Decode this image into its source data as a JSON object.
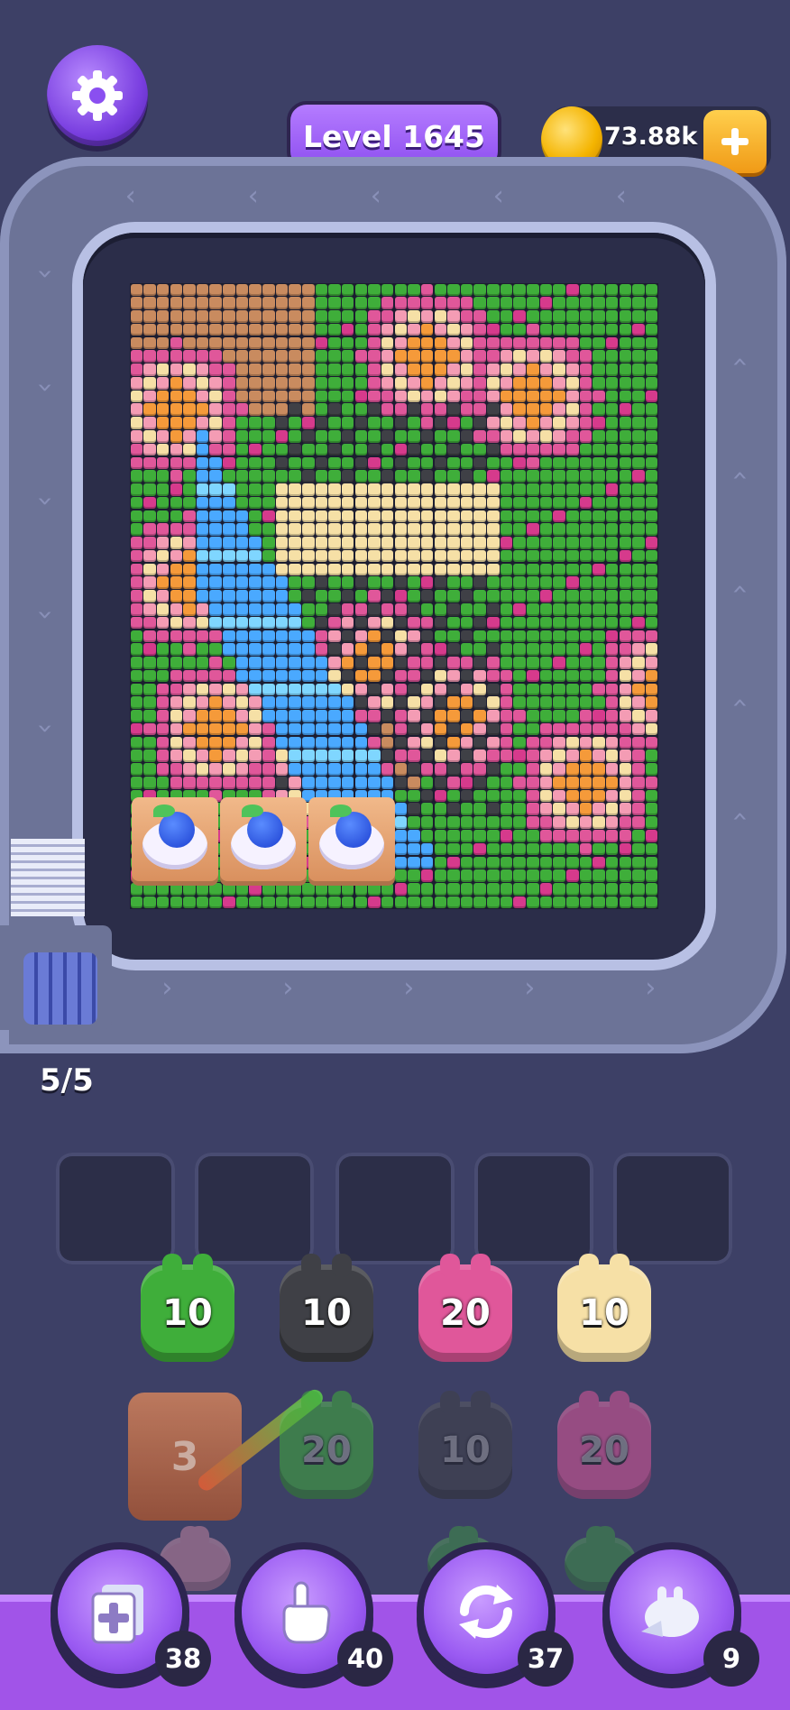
{
  "header": {
    "level_label": "Level 1645",
    "coins": "73.88k"
  },
  "conveyor": {
    "counter": "5/5",
    "loaded_items": [
      "blueberry-cat",
      "blueberry-cat",
      "blueberry-cat"
    ]
  },
  "palette": {
    "pink": "#e0579a",
    "lightpink": "#f49cb4",
    "green": "#3fae3a",
    "dark": "#3f4046",
    "blue": "#4aa9ff",
    "cyan": "#7fd6ff",
    "cream": "#f6e0a6",
    "orange": "#f59a3a",
    "tan": "#c98b5f",
    "brown": "#8a5a3c",
    "white": "#f2f4ff",
    "magenta": "#d63a8c"
  },
  "slots_count": 5,
  "pieces": {
    "row1": [
      {
        "color": "green",
        "value": "10"
      },
      {
        "color": "dark",
        "value": "10"
      },
      {
        "color": "magenta",
        "value": "20"
      },
      {
        "color": "cream",
        "value": "10"
      }
    ],
    "row2": [
      {
        "color": "box",
        "value": "3"
      },
      {
        "color": "green",
        "value": "20"
      },
      {
        "color": "dark",
        "value": "10"
      },
      {
        "color": "magenta",
        "value": "20"
      }
    ]
  },
  "tools": [
    {
      "name": "add-slot",
      "count": "38"
    },
    {
      "name": "hand",
      "count": "40"
    },
    {
      "name": "shuffle",
      "count": "37"
    },
    {
      "name": "vacuum",
      "count": "9"
    }
  ]
}
